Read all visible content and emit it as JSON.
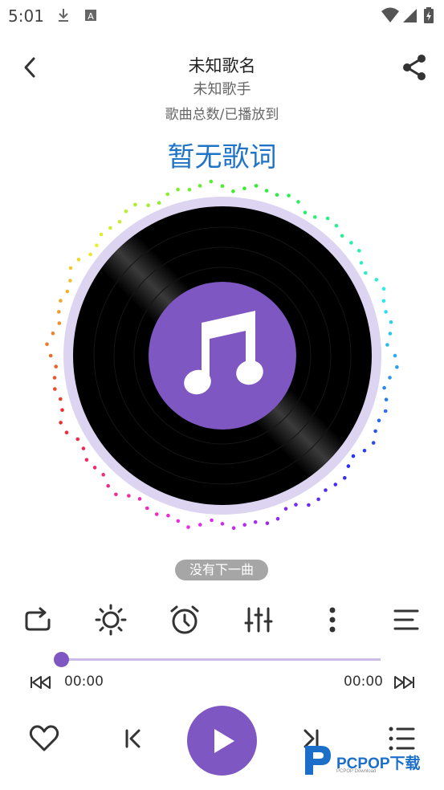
{
  "status_bar": {
    "time": "5:01",
    "icons": [
      "download-icon",
      "a-icon",
      "wifi-icon",
      "signal-icon",
      "battery-icon"
    ]
  },
  "header": {
    "title": "未知歌名",
    "artist": "未知歌手",
    "count_text": "歌曲总数/已播放到"
  },
  "lyrics": "暂无歌词",
  "disc": {
    "center_icon": "music-note-icon"
  },
  "tip": "没有下一曲",
  "controls": [
    "repeat-icon",
    "brightness-icon",
    "alarm-icon",
    "equalizer-icon",
    "more-icon",
    "menu-icon"
  ],
  "progress": {
    "current": "00:00",
    "total": "00:00",
    "fraction": 0
  },
  "bottom_bar": [
    "heart-icon",
    "previous-icon",
    "play-icon",
    "next-icon",
    "playlist-icon"
  ],
  "colors": {
    "accent": "#7e57c2",
    "lyrics": "#1f74c8",
    "track": "#cbbde6"
  },
  "watermark": {
    "brand": "PCPOP下载",
    "sub": "PCPOP Download"
  }
}
